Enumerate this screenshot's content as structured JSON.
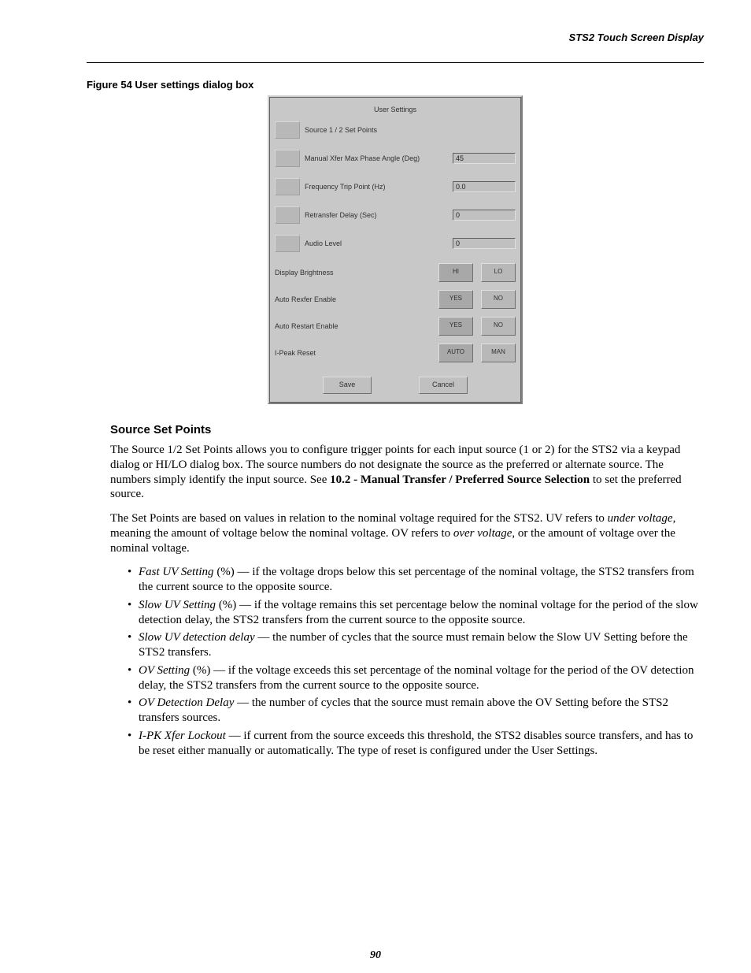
{
  "header": {
    "doc_title": "STS2 Touch Screen Display"
  },
  "figure": {
    "caption": "Figure 54  User settings dialog box"
  },
  "dialog": {
    "title": "User Settings",
    "rows": [
      {
        "label": "Source 1 / 2 Set Points",
        "value": ""
      },
      {
        "label": "Manual Xfer Max Phase Angle (Deg)",
        "value": "45"
      },
      {
        "label": "Frequency Trip Point (Hz)",
        "value": "0.0"
      },
      {
        "label": "Retransfer Delay (Sec)",
        "value": "0"
      },
      {
        "label": "Audio Level",
        "value": "0"
      }
    ],
    "toggles": [
      {
        "label": "Display Brightness",
        "opt1": "HI",
        "opt2": "LO"
      },
      {
        "label": "Auto Rexfer Enable",
        "opt1": "YES",
        "opt2": "NO"
      },
      {
        "label": "Auto Restart Enable",
        "opt1": "YES",
        "opt2": "NO"
      },
      {
        "label": "I-Peak Reset",
        "opt1": "AUTO",
        "opt2": "MAN"
      }
    ],
    "buttons": {
      "save": "Save",
      "cancel": "Cancel"
    }
  },
  "section": {
    "heading": "Source Set Points",
    "para1_a": "The Source 1/2 Set Points allows you to configure trigger points for each input source (1 or 2) for the STS2 via a keypad dialog or HI/LO dialog box. The source numbers do not designate the source as the preferred or alternate source. The numbers simply identify the input source. See ",
    "para1_bold": "10.2 - Manual Transfer / Preferred Source Selection",
    "para1_b": " to set the preferred source.",
    "para2_a": "The Set Points are based on values in relation to the nominal voltage required for the STS2. UV refers to ",
    "para2_i1": "under voltage",
    "para2_b": ", meaning the amount of voltage below the nominal voltage. OV refers to ",
    "para2_i2": "over voltage",
    "para2_c": ", or the amount of voltage over the nominal voltage."
  },
  "bullets": [
    {
      "term": "Fast UV Setting",
      "suffix": " (%) — ",
      "text": "if the voltage drops below this set percentage of the nominal voltage, the STS2 transfers from the current source to the opposite source."
    },
    {
      "term": "Slow UV Setting",
      "suffix": " (%) — ",
      "text": "if the voltage remains this set percentage below the nominal voltage for the period of the slow detection delay, the STS2 transfers from the current source to the opposite source."
    },
    {
      "term": "Slow UV detection delay",
      "suffix": " — ",
      "text": "the number of cycles that the source must remain below the Slow UV Setting before the STS2 transfers."
    },
    {
      "term": "OV Setting",
      "suffix": " (%) — ",
      "text": "if the voltage exceeds this set percentage of the nominal voltage for the period of the OV detection delay, the STS2 transfers from the current source to the opposite source."
    },
    {
      "term": "OV Detection Delay",
      "suffix": " — ",
      "text": "the number of cycles that the source must remain above the OV Setting before the STS2 transfers sources."
    },
    {
      "term": "I-PK Xfer Lockout",
      "suffix": " — ",
      "text": "if current from the source exceeds this threshold, the STS2 disables source transfers, and has to be reset either manually or automatically. The type of reset is configured under the User Settings."
    }
  ],
  "page_number": "90"
}
